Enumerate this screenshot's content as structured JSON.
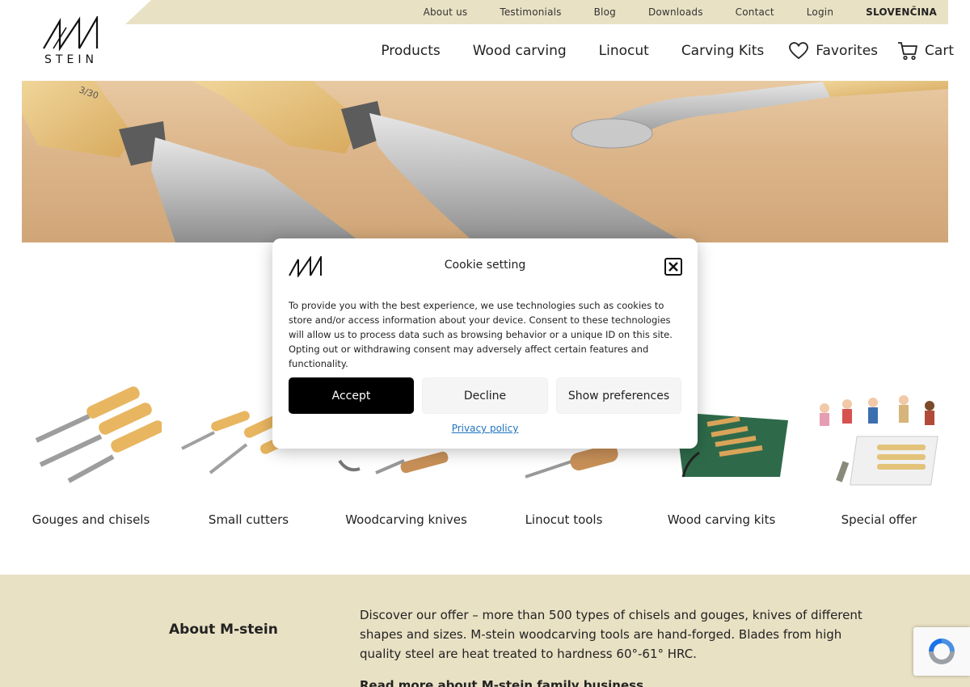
{
  "topbar": {
    "links": [
      "About us",
      "Testimonials",
      "Blog",
      "Downloads",
      "Contact",
      "Login"
    ],
    "language": "SLOVENČINA"
  },
  "logo": {
    "text": "STEIN"
  },
  "nav": {
    "products": "Products",
    "wood_carving": "Wood carving",
    "linocut": "Linocut",
    "carving_kits": "Carving Kits",
    "favorites": "Favorites",
    "cart": "Cart"
  },
  "categories": [
    {
      "label": "Gouges and chisels"
    },
    {
      "label": "Small cutters"
    },
    {
      "label": "Woodcarving knives"
    },
    {
      "label": "Linocut tools"
    },
    {
      "label": "Wood carving kits"
    },
    {
      "label": "Special offer"
    }
  ],
  "about": {
    "title": "About M-stein",
    "text": "Discover our offer – more than 500 types of chisels and gouges, knives of different shapes and sizes. M-stein woodcarving tools are hand-forged. Blades from high quality steel are heat treated to hardness 60°-61° HRC.",
    "read_more": "Read more about M-stein family business"
  },
  "cookie": {
    "title": "Cookie setting",
    "text": "To provide you with the best experience, we use technologies such as cookies to store and/or access information about your device. Consent to these technologies will allow us to process data such as browsing behavior or a unique ID on this site. Opting out or withdrawing consent may adversely affect certain features and functionality.",
    "accept": "Accept",
    "decline": "Decline",
    "preferences": "Show preferences",
    "privacy": "Privacy policy"
  },
  "colors": {
    "beige": "#e9e1c4",
    "accent_dark": "#000000",
    "link_blue": "#1e73be"
  }
}
